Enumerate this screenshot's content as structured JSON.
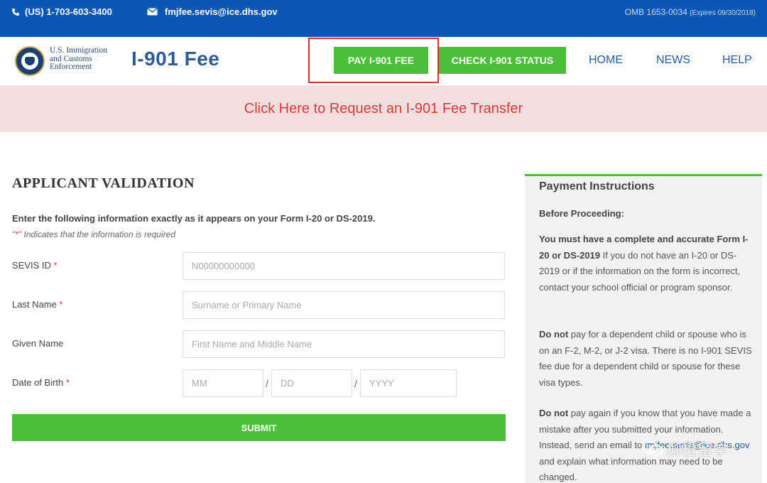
{
  "topbar": {
    "phone": "(US) 1-703-603-3400",
    "email": "fmjfee.sevis@ice.dhs.gov",
    "omb": "OMB 1653-0034",
    "omb_expires": "(Expires 09/30/2018)",
    "phone_icon": "phone-icon",
    "email_icon": "envelope-icon"
  },
  "header": {
    "agency_line1": "U.S. Immigration",
    "agency_line2": "and Customs",
    "agency_line3": "Enforcement",
    "title": "I-901 Fee",
    "pay_button": "PAY I-901 FEE",
    "check_button": "CHECK I-901 STATUS",
    "nav": [
      "HOME",
      "NEWS",
      "HELP"
    ]
  },
  "banner": {
    "text": "Click Here to Request an I-901 Fee Transfer"
  },
  "form": {
    "title": "APPLICANT VALIDATION",
    "intro": "Enter the following information exactly as it appears on your Form I-20 or DS-2019.",
    "note_mark": "\"*\"",
    "note": " Indicates that the information is required",
    "fields": {
      "sevis_label": "SEVIS ID",
      "sevis_placeholder": "N00000000000",
      "last_label": "Last Name",
      "last_placeholder": "Surname or Primary Name",
      "given_label": "Given Name",
      "given_placeholder": "First Name and Middle Name",
      "dob_label": "Date of Birth",
      "mm_placeholder": "MM",
      "dd_placeholder": "DD",
      "yyyy_placeholder": "YYYY",
      "required_mark": "*",
      "separator": "/"
    },
    "submit": "SUBMIT"
  },
  "sidebar": {
    "title": "Payment Instructions",
    "subtitle": "Before Proceeding:",
    "p1_bold": "You must have a complete and accurate Form I-20 or DS-2019",
    "p1_rest": " If you do not have an I-20 or DS-2019 or if the information on the form is incorrect, contact your school official or program sponsor.",
    "p2_bold": "Do not",
    "p2_rest": " pay for a dependent child or spouse who is on an F-2, M-2, or J-2 visa. There is no I-901 SEVIS fee due for a dependent child or spouse for these visa types.",
    "p3_bold": "Do not",
    "p3_rest1": " pay again if you know that you have made a mistake after you submitted your information. Instead, send an email to ",
    "p3_link": "fmjfee.sevis@ice.dhs.gov",
    "p3_rest2": " and explain what information may need to be changed."
  },
  "watermark": {
    "text": "柳橙留学"
  },
  "colors": {
    "topbar": "#0b57b5",
    "accent_green": "#4cbf3a",
    "banner_bg": "#f2dede",
    "banner_text": "#d53a3a",
    "link_blue": "#1e5d9a",
    "highlight_red": "#d8302f"
  }
}
